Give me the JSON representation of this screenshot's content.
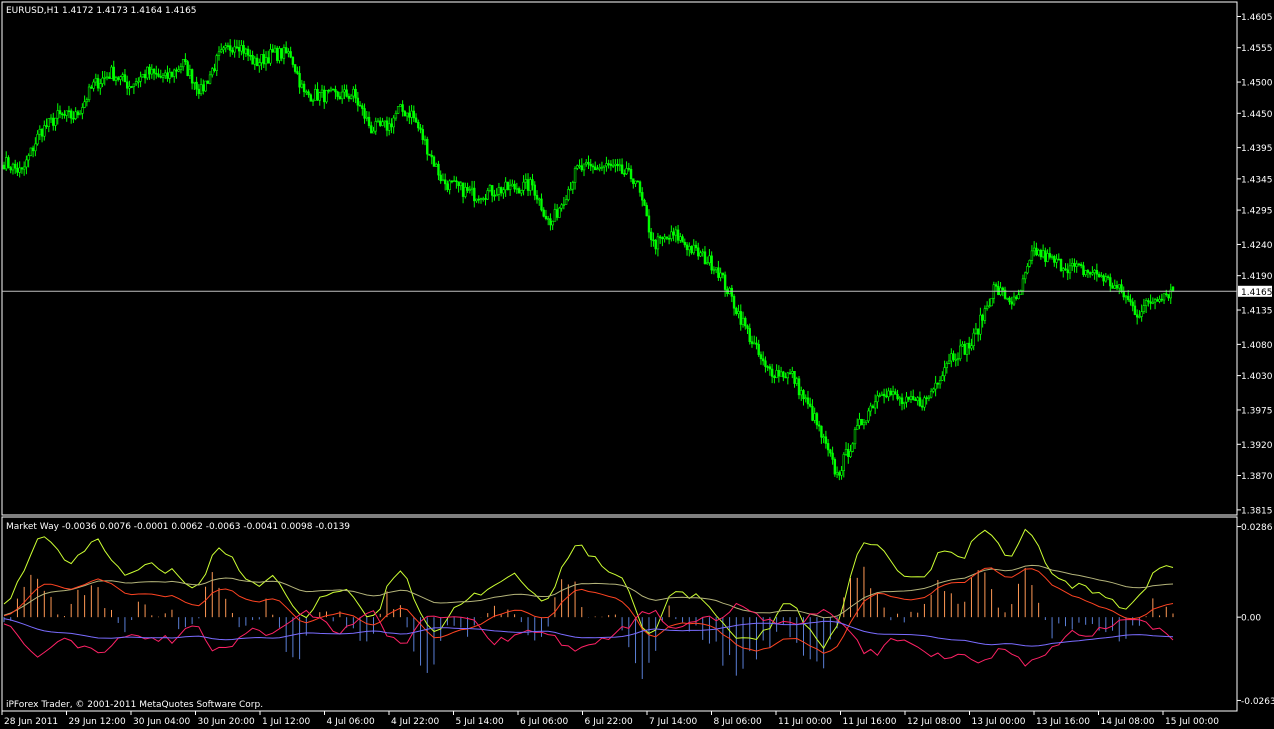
{
  "main_header": "EURUSD,H1  1.4172 1.4173 1.4164 1.4165",
  "sub_header": "Market Way -0.0036 0.0076 -0.0001 0.0062 -0.0063 -0.0041 0.0098 -0.0139",
  "copyright": "iPForex Trader, © 2001-2011 MetaQuotes Software Corp.",
  "current_price_label": "1.4165",
  "colors": {
    "background": "#000000",
    "frame": "#ffffff",
    "candles": "#00ff00",
    "price_line": "#c0c0c0",
    "hist_orange": "#ff9955",
    "hist_blue": "#5a7fd6",
    "line_yellowgreen": "#ccff33",
    "line_olive": "#b4b47a",
    "line_orange": "#ff4422",
    "line_red": "#ff2266",
    "line_violet": "#7a6cff"
  },
  "chart_data": [
    {
      "type": "candlestick",
      "symbol": "EURUSD",
      "timeframe": "H1",
      "ohlc_last": {
        "open": 1.4172,
        "high": 1.4173,
        "low": 1.4164,
        "close": 1.4165
      },
      "y_tick_labels": [
        "1.4605",
        "1.4555",
        "1.4500",
        "1.4450",
        "1.4395",
        "1.4345",
        "1.4295",
        "1.4240",
        "1.4190",
        "1.4135",
        "1.4080",
        "1.4030",
        "1.3975",
        "1.3920",
        "1.3870",
        "1.3815"
      ],
      "y_ticks": [
        1.4605,
        1.4555,
        1.45,
        1.445,
        1.4395,
        1.4345,
        1.4295,
        1.424,
        1.419,
        1.4135,
        1.408,
        1.403,
        1.3975,
        1.392,
        1.387,
        1.3815
      ],
      "ylim": [
        1.381,
        1.4625
      ],
      "current_price": 1.4165,
      "x_tick_labels": [
        "28 Jun 2011",
        "29 Jun 12:00",
        "30 Jun 04:00",
        "30 Jun 20:00",
        "1 Jul 12:00",
        "4 Jul 06:00",
        "4 Jul 22:00",
        "5 Jul 14:00",
        "6 Jul 06:00",
        "6 Jul 22:00",
        "7 Jul 14:00",
        "8 Jul 06:00",
        "11 Jul 00:00",
        "11 Jul 16:00",
        "12 Jul 08:00",
        "13 Jul 00:00",
        "13 Jul 16:00",
        "14 Jul 08:00",
        "15 Jul 00:00"
      ],
      "close_path_keypoints": [
        [
          0,
          1.4372
        ],
        [
          8,
          1.4355
        ],
        [
          16,
          1.442
        ],
        [
          24,
          1.4445
        ],
        [
          32,
          1.4445
        ],
        [
          40,
          1.4495
        ],
        [
          48,
          1.4515
        ],
        [
          56,
          1.4495
        ],
        [
          64,
          1.4515
        ],
        [
          72,
          1.4505
        ],
        [
          80,
          1.453
        ],
        [
          88,
          1.4485
        ],
        [
          96,
          1.454
        ],
        [
          104,
          1.4565
        ],
        [
          112,
          1.453
        ],
        [
          120,
          1.4545
        ],
        [
          128,
          1.4545
        ],
        [
          134,
          1.448
        ],
        [
          146,
          1.4478
        ],
        [
          156,
          1.448
        ],
        [
          164,
          1.4425
        ],
        [
          172,
          1.443
        ],
        [
          176,
          1.4455
        ],
        [
          182,
          1.445
        ],
        [
          196,
          1.434
        ],
        [
          210,
          1.432
        ],
        [
          222,
          1.4328
        ],
        [
          236,
          1.4335
        ],
        [
          244,
          1.427
        ],
        [
          256,
          1.436
        ],
        [
          270,
          1.4365
        ],
        [
          282,
          1.4345
        ],
        [
          290,
          1.424
        ],
        [
          300,
          1.4255
        ],
        [
          306,
          1.4235
        ],
        [
          318,
          1.4205
        ],
        [
          330,
          1.4115
        ],
        [
          340,
          1.404
        ],
        [
          352,
          1.403
        ],
        [
          362,
          1.396
        ],
        [
          372,
          1.387
        ],
        [
          382,
          1.395
        ],
        [
          392,
          1.401
        ],
        [
          402,
          1.3985
        ],
        [
          412,
          1.399
        ],
        [
          422,
          1.406
        ],
        [
          432,
          1.408
        ],
        [
          442,
          1.417
        ],
        [
          452,
          1.4145
        ],
        [
          460,
          1.423
        ],
        [
          470,
          1.421
        ],
        [
          480,
          1.42
        ],
        [
          490,
          1.419
        ],
        [
          500,
          1.416
        ],
        [
          506,
          1.413
        ],
        [
          516,
          1.416
        ],
        [
          522,
          1.4165
        ]
      ]
    },
    {
      "type": "indicator",
      "name": "Market Way",
      "values": [
        -0.0036,
        0.0076,
        -0.0001,
        0.0062,
        -0.0063,
        -0.0041,
        0.0098,
        -0.0139
      ],
      "y_tick_labels": [
        "0.0286",
        "0.00",
        "-0.0263"
      ],
      "y_ticks": [
        0.0286,
        0.0,
        -0.0263
      ],
      "ylim": [
        -0.029,
        0.031
      ]
    }
  ]
}
